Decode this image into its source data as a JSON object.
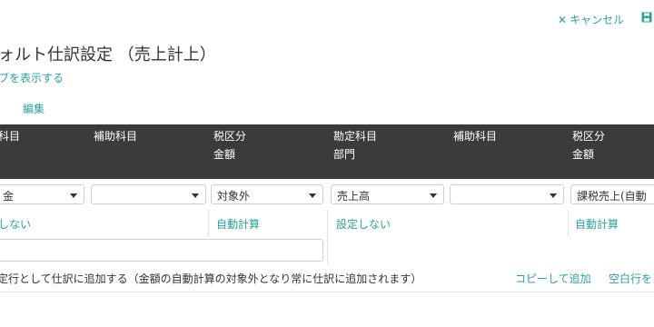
{
  "toolbar": {
    "cancel_label": "キャンセル",
    "save_icon": "save-icon"
  },
  "page": {
    "title": "ォルト仕訳設定 （売上計上）",
    "toggle_link": "ブを表示する",
    "edit_link": "編集"
  },
  "table": {
    "headers": {
      "col1": "科目",
      "col2": "補助科目",
      "col3_line1": "税区分",
      "col3_line2": "金額",
      "col4_line1": "勘定科目",
      "col4_line2": "部門",
      "col5": "補助科目",
      "col6_line1": "税区分",
      "col6_line2": "金額"
    },
    "row": {
      "debit_account": "金",
      "debit_sub": "",
      "debit_tax": "対象外",
      "credit_account": "売上高",
      "credit_sub": "",
      "credit_tax": "課税売上(自動判",
      "debit_dept_link": "しない",
      "debit_amount_link": "自動計算",
      "credit_dept_link": "設定しない",
      "credit_amount_link": "自動計算",
      "memo_value": ""
    }
  },
  "footer": {
    "note": "定行として仕訳に追加する（金額の自動計算の対象外となり常に仕訳に追加されます）",
    "copy_link": "コピーして追加",
    "blank_link": "空白行を"
  }
}
